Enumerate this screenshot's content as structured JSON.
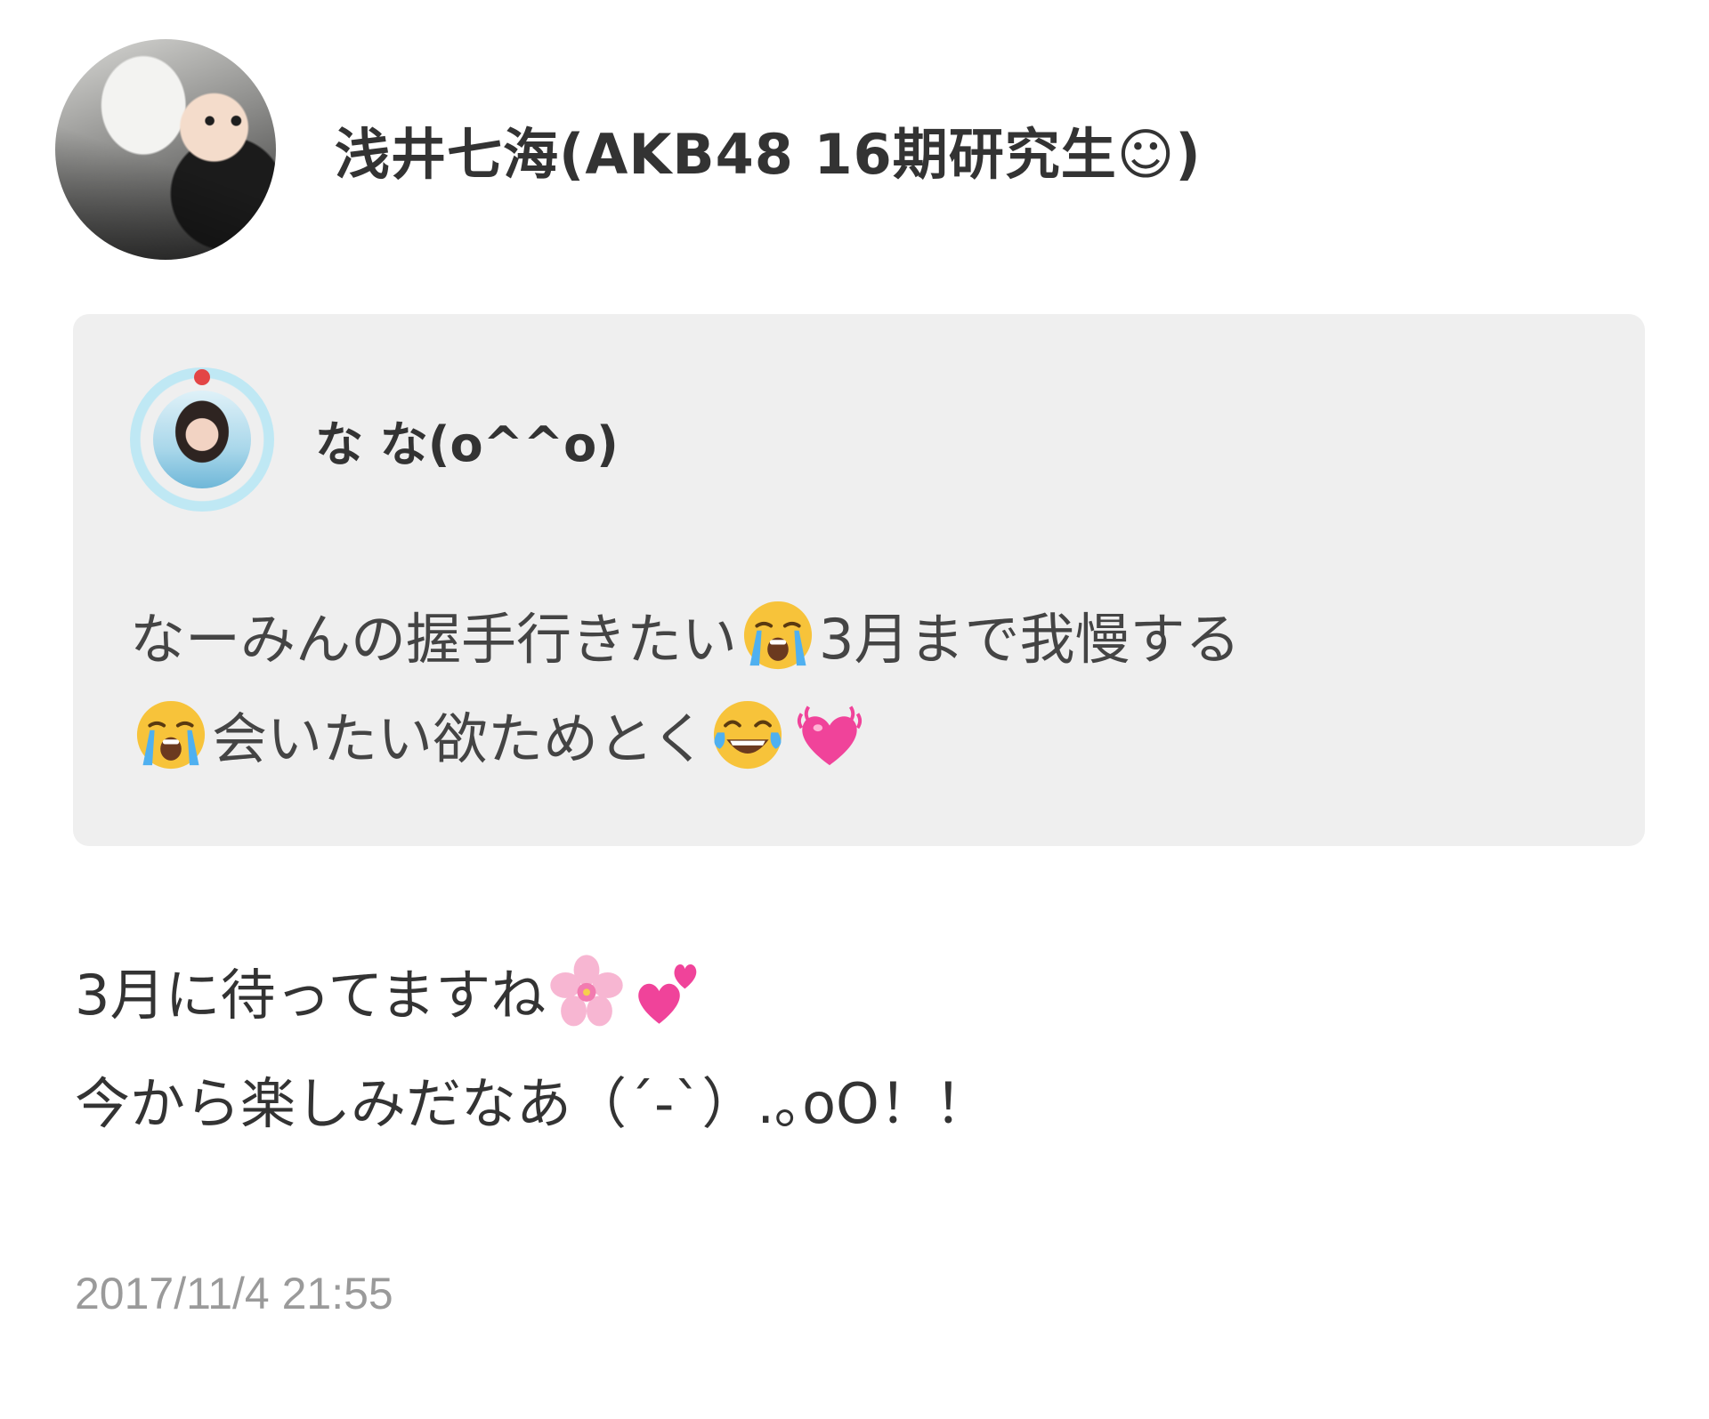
{
  "post": {
    "author_name": "浅井七海(AKB48 16期研究生☺)",
    "timestamp": "2017/11/4 21:55",
    "reply_lines": [
      "3月に待ってますね",
      "今から楽しみだなあ（´-`）.｡oO！！"
    ]
  },
  "quoted_post": {
    "author_name": "な な(o^^o)",
    "text_segments": [
      "なーみんの握手行きたい",
      "3月まで我慢する",
      "会いたい欲ためとく"
    ]
  },
  "icons": {
    "author_avatar": "avatar-photo",
    "quoted_avatar": "avatar-photo",
    "emoji_1": "loudly-crying-face-icon",
    "emoji_2": "loudly-crying-face-icon",
    "emoji_3": "face-with-tears-of-joy-icon",
    "emoji_4": "beating-heart-icon",
    "emoji_5": "cherry-blossom-icon",
    "emoji_6": "two-hearts-icon"
  },
  "colors": {
    "quote_background": "#efefef",
    "timestamp": "#9a9a9a",
    "heart_pink": "#f0439a"
  }
}
